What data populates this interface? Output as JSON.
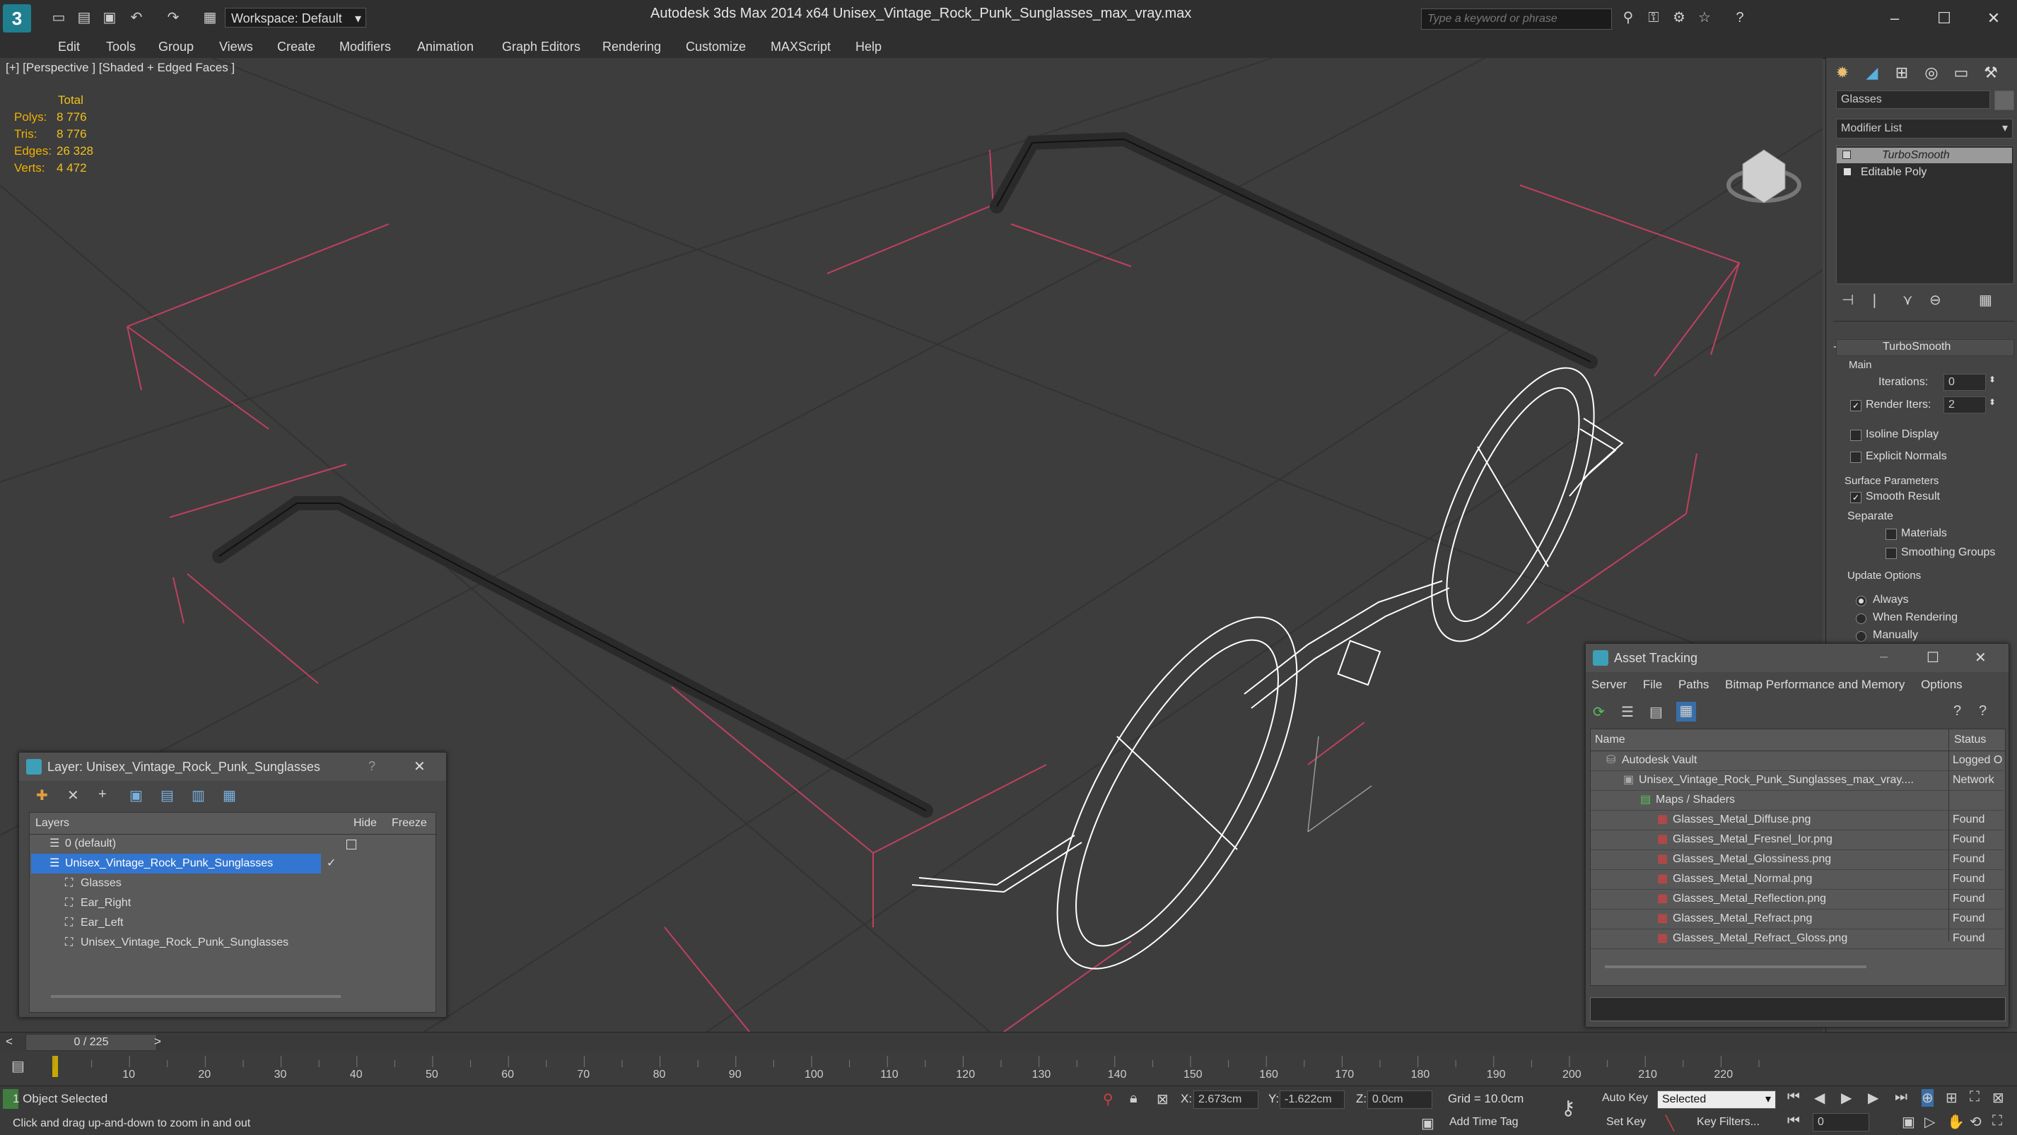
{
  "app": {
    "title": "Autodesk 3ds Max  2014 x64     Unisex_Vintage_Rock_Punk_Sunglasses_max_vray.max",
    "workspace": "Workspace: Default",
    "search_placeholder": "Type a keyword or phrase"
  },
  "menu": [
    "Edit",
    "Tools",
    "Group",
    "Views",
    "Create",
    "Modifiers",
    "Animation",
    "Graph Editors",
    "Rendering",
    "Customize",
    "MAXScript",
    "Help"
  ],
  "viewport": {
    "label": "[+] [Perspective ] [Shaded + Edged Faces ]",
    "stats_header": "Total",
    "stats": [
      {
        "key": "Polys:",
        "value": "8 776"
      },
      {
        "key": "Tris:",
        "value": "8 776"
      },
      {
        "key": "Edges:",
        "value": "26 328"
      },
      {
        "key": "Verts:",
        "value": "4 472"
      }
    ]
  },
  "command_panel": {
    "object_name": "Glasses",
    "modifier_list": "Modifier List",
    "stack": [
      "TurboSmooth",
      "Editable Poly"
    ],
    "rollout_title": "TurboSmooth",
    "main_label": "Main",
    "iterations_label": "Iterations:",
    "iterations_value": "0",
    "render_iters_label": "Render Iters:",
    "render_iters_value": "2",
    "isoline_label": "Isoline Display",
    "explicit_normals_label": "Explicit Normals",
    "surface_params_label": "Surface Parameters",
    "smooth_result_label": "Smooth Result",
    "separate_label": "Separate",
    "materials_label": "Materials",
    "smoothing_groups_label": "Smoothing Groups",
    "update_options_label": "Update Options",
    "always_label": "Always",
    "when_rendering_label": "When Rendering",
    "manually_label": "Manually"
  },
  "layer_dialog": {
    "title": "Layer: Unisex_Vintage_Rock_Punk_Sunglasses",
    "help": "?",
    "col_layers": "Layers",
    "col_hide": "Hide",
    "col_freeze": "Freeze",
    "rows": [
      {
        "name": "0 (default)",
        "indent": 0
      },
      {
        "name": "Unisex_Vintage_Rock_Punk_Sunglasses",
        "indent": 0
      },
      {
        "name": "Glasses",
        "indent": 1
      },
      {
        "name": "Ear_Right",
        "indent": 1
      },
      {
        "name": "Ear_Left",
        "indent": 1
      },
      {
        "name": "Unisex_Vintage_Rock_Punk_Sunglasses",
        "indent": 1
      }
    ]
  },
  "asset_dialog": {
    "title": "Asset Tracking",
    "menu": [
      "Server",
      "File",
      "Paths",
      "Bitmap Performance and Memory",
      "Options"
    ],
    "col_name": "Name",
    "col_status": "Status",
    "rows": [
      {
        "name": "Autodesk Vault",
        "status": "Logged O",
        "indent": 0
      },
      {
        "name": "Unisex_Vintage_Rock_Punk_Sunglasses_max_vray....",
        "status": "Network",
        "indent": 1
      },
      {
        "name": "Maps / Shaders",
        "status": "",
        "indent": 2
      },
      {
        "name": "Glasses_Metal_Diffuse.png",
        "status": "Found",
        "indent": 3
      },
      {
        "name": "Glasses_Metal_Fresnel_Ior.png",
        "status": "Found",
        "indent": 3
      },
      {
        "name": "Glasses_Metal_Glossiness.png",
        "status": "Found",
        "indent": 3
      },
      {
        "name": "Glasses_Metal_Normal.png",
        "status": "Found",
        "indent": 3
      },
      {
        "name": "Glasses_Metal_Reflection.png",
        "status": "Found",
        "indent": 3
      },
      {
        "name": "Glasses_Metal_Refract.png",
        "status": "Found",
        "indent": 3
      },
      {
        "name": "Glasses_Metal_Refract_Gloss.png",
        "status": "Found",
        "indent": 3
      }
    ]
  },
  "timeline": {
    "frame_counter": "0 / 225",
    "ticks": [
      "10",
      "20",
      "30",
      "40",
      "50",
      "60",
      "70",
      "80",
      "90",
      "100",
      "110",
      "120",
      "130",
      "140",
      "150",
      "160",
      "170",
      "180",
      "190",
      "200",
      "210",
      "220"
    ]
  },
  "status": {
    "selection": "1 Object Selected",
    "prompt": "Click and drag up-and-down to zoom in and out",
    "x_label": "X:",
    "x_value": "2.673cm",
    "y_label": "Y:",
    "y_value": "-1.622cm",
    "z_label": "Z:",
    "z_value": "0.0cm",
    "grid": "Grid = 10.0cm",
    "add_time_tag": "Add Time Tag",
    "auto_key": "Auto Key",
    "set_key": "Set Key",
    "selected": "Selected",
    "key_filters": "Key Filters...",
    "frame": "0"
  }
}
